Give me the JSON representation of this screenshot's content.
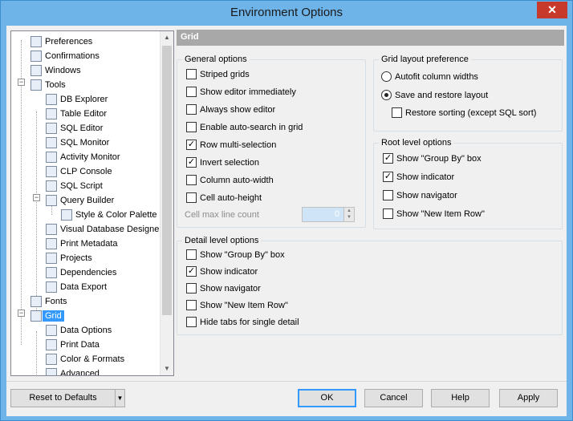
{
  "window": {
    "title": "Environment Options",
    "close_glyph": "✕"
  },
  "tree": {
    "items": [
      {
        "label": "Preferences",
        "icon": "preferences-icon"
      },
      {
        "label": "Confirmations",
        "icon": "confirmations-icon"
      },
      {
        "label": "Windows",
        "icon": "windows-icon"
      },
      {
        "label": "Tools",
        "icon": "tools-icon"
      },
      {
        "label": "DB Explorer",
        "icon": "db-explorer-icon"
      },
      {
        "label": "Table Editor",
        "icon": "table-editor-icon"
      },
      {
        "label": "SQL Editor",
        "icon": "sql-editor-icon"
      },
      {
        "label": "SQL Monitor",
        "icon": "sql-monitor-icon"
      },
      {
        "label": "Activity Monitor",
        "icon": "activity-monitor-icon"
      },
      {
        "label": "CLP Console",
        "icon": "clp-console-icon"
      },
      {
        "label": "SQL Script",
        "icon": "sql-script-icon"
      },
      {
        "label": "Query Builder",
        "icon": "query-builder-icon"
      },
      {
        "label": "Style & Color Palette",
        "icon": "palette-icon"
      },
      {
        "label": "Visual Database Designe",
        "icon": "visual-designer-icon"
      },
      {
        "label": "Print Metadata",
        "icon": "print-metadata-icon"
      },
      {
        "label": "Projects",
        "icon": "projects-icon"
      },
      {
        "label": "Dependencies",
        "icon": "dependencies-icon"
      },
      {
        "label": "Data Export",
        "icon": "data-export-icon"
      },
      {
        "label": "Fonts",
        "icon": "fonts-icon"
      },
      {
        "label": "Grid",
        "icon": "grid-icon"
      },
      {
        "label": "Data Options",
        "icon": "data-options-icon"
      },
      {
        "label": "Print Data",
        "icon": "print-data-icon"
      },
      {
        "label": "Color & Formats",
        "icon": "color-formats-icon"
      },
      {
        "label": "Advanced",
        "icon": "advanced-icon"
      }
    ],
    "selected": "Grid"
  },
  "panel": {
    "header": "Grid",
    "general": {
      "title": "General options",
      "options": [
        {
          "label": "Striped grids",
          "checked": false
        },
        {
          "label": "Show editor immediately",
          "checked": false
        },
        {
          "label": "Always show editor",
          "checked": false
        },
        {
          "label": "Enable auto-search in grid",
          "checked": false
        },
        {
          "label": "Row multi-selection",
          "checked": true
        },
        {
          "label": "Invert selection",
          "checked": true
        },
        {
          "label": "Column auto-width",
          "checked": false
        },
        {
          "label": "Cell auto-height",
          "checked": false
        }
      ],
      "cell_max_label": "Cell max line count",
      "cell_max_value": "0"
    },
    "layout": {
      "title": "Grid layout preference",
      "autofit": "Autofit column widths",
      "save_restore": "Save and restore layout",
      "restore_sorting": "Restore sorting (except SQL sort)",
      "selected": "save_restore"
    },
    "root": {
      "title": "Root level options",
      "options": [
        {
          "label": "Show \"Group By\" box",
          "checked": true
        },
        {
          "label": "Show indicator",
          "checked": true
        },
        {
          "label": "Show navigator",
          "checked": false
        },
        {
          "label": "Show \"New Item Row\"",
          "checked": false
        }
      ]
    },
    "detail": {
      "title": "Detail level options",
      "options": [
        {
          "label": "Show \"Group By\" box",
          "checked": false
        },
        {
          "label": "Show indicator",
          "checked": true
        },
        {
          "label": "Show navigator",
          "checked": false
        },
        {
          "label": "Show \"New Item Row\"",
          "checked": false
        },
        {
          "label": "Hide tabs for single detail",
          "checked": false
        }
      ]
    }
  },
  "buttons": {
    "reset": "Reset to Defaults",
    "ok": "OK",
    "cancel": "Cancel",
    "help": "Help",
    "apply": "Apply"
  }
}
